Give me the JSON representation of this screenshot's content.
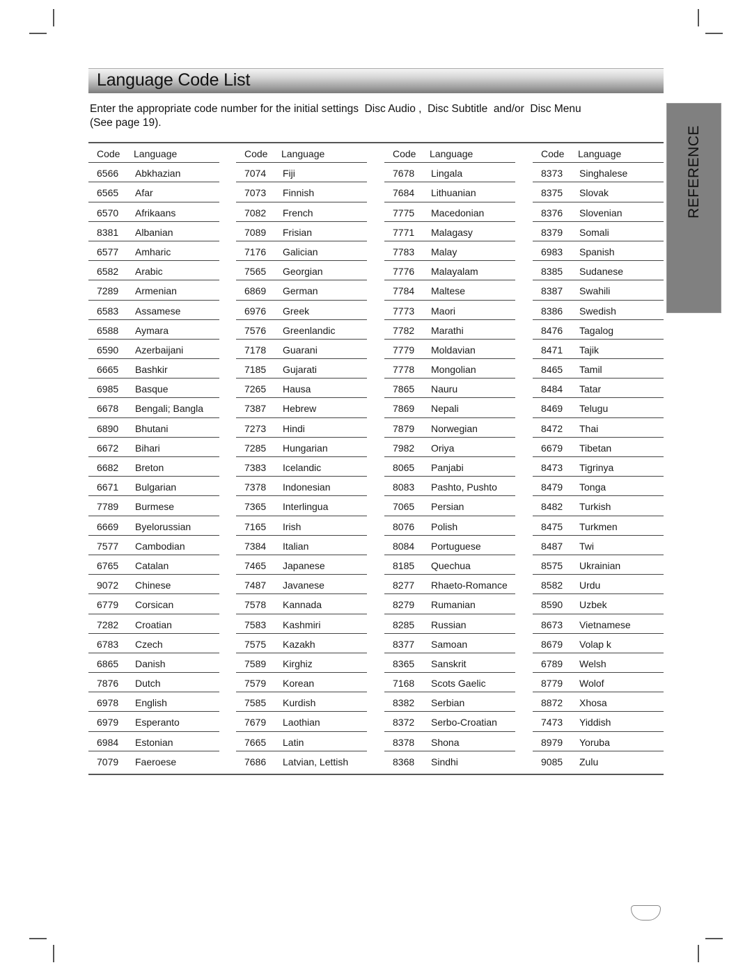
{
  "page": {
    "title": "Language Code List",
    "intro": "Enter the appropriate code number for the initial settings  Disc Audio ,  Disc Subtitle  and/or  Disc Menu",
    "intro_line2": "(See page 19).",
    "side_tab": "REFERENCE",
    "page_number": ""
  },
  "table": {
    "headers": {
      "code": "Code",
      "language": "Language"
    },
    "columns": [
      [
        {
          "code": "6566",
          "language": "Abkhazian"
        },
        {
          "code": "6565",
          "language": "Afar"
        },
        {
          "code": "6570",
          "language": "Afrikaans"
        },
        {
          "code": "8381",
          "language": "Albanian"
        },
        {
          "code": "6577",
          "language": "Amharic"
        },
        {
          "code": "6582",
          "language": "Arabic"
        },
        {
          "code": "7289",
          "language": "Armenian"
        },
        {
          "code": "6583",
          "language": "Assamese"
        },
        {
          "code": "6588",
          "language": "Aymara"
        },
        {
          "code": "6590",
          "language": "Azerbaijani"
        },
        {
          "code": "6665",
          "language": "Bashkir"
        },
        {
          "code": "6985",
          "language": "Basque"
        },
        {
          "code": "6678",
          "language": "Bengali; Bangla"
        },
        {
          "code": "6890",
          "language": "Bhutani"
        },
        {
          "code": "6672",
          "language": "Bihari"
        },
        {
          "code": "6682",
          "language": "Breton"
        },
        {
          "code": "6671",
          "language": "Bulgarian"
        },
        {
          "code": "7789",
          "language": "Burmese"
        },
        {
          "code": "6669",
          "language": "Byelorussian"
        },
        {
          "code": "7577",
          "language": "Cambodian"
        },
        {
          "code": "6765",
          "language": "Catalan"
        },
        {
          "code": "9072",
          "language": "Chinese"
        },
        {
          "code": "6779",
          "language": "Corsican"
        },
        {
          "code": "7282",
          "language": "Croatian"
        },
        {
          "code": "6783",
          "language": "Czech"
        },
        {
          "code": "6865",
          "language": "Danish"
        },
        {
          "code": "7876",
          "language": "Dutch"
        },
        {
          "code": "6978",
          "language": "English"
        },
        {
          "code": "6979",
          "language": "Esperanto"
        },
        {
          "code": "6984",
          "language": "Estonian"
        },
        {
          "code": "7079",
          "language": "Faeroese"
        }
      ],
      [
        {
          "code": "7074",
          "language": "Fiji"
        },
        {
          "code": "7073",
          "language": "Finnish"
        },
        {
          "code": "7082",
          "language": "French"
        },
        {
          "code": "7089",
          "language": "Frisian"
        },
        {
          "code": "7176",
          "language": "Galician"
        },
        {
          "code": "7565",
          "language": "Georgian"
        },
        {
          "code": "6869",
          "language": "German"
        },
        {
          "code": "6976",
          "language": "Greek"
        },
        {
          "code": "7576",
          "language": "Greenlandic"
        },
        {
          "code": "7178",
          "language": "Guarani"
        },
        {
          "code": "7185",
          "language": "Gujarati"
        },
        {
          "code": "7265",
          "language": "Hausa"
        },
        {
          "code": "7387",
          "language": "Hebrew"
        },
        {
          "code": "7273",
          "language": "Hindi"
        },
        {
          "code": "7285",
          "language": "Hungarian"
        },
        {
          "code": "7383",
          "language": "Icelandic"
        },
        {
          "code": "7378",
          "language": "Indonesian"
        },
        {
          "code": "7365",
          "language": "Interlingua"
        },
        {
          "code": "7165",
          "language": "Irish"
        },
        {
          "code": "7384",
          "language": "Italian"
        },
        {
          "code": "7465",
          "language": "Japanese"
        },
        {
          "code": "7487",
          "language": "Javanese"
        },
        {
          "code": "7578",
          "language": "Kannada"
        },
        {
          "code": "7583",
          "language": "Kashmiri"
        },
        {
          "code": "7575",
          "language": "Kazakh"
        },
        {
          "code": "7589",
          "language": "Kirghiz"
        },
        {
          "code": "7579",
          "language": "Korean"
        },
        {
          "code": "7585",
          "language": "Kurdish"
        },
        {
          "code": "7679",
          "language": "Laothian"
        },
        {
          "code": "7665",
          "language": "Latin"
        },
        {
          "code": "7686",
          "language": "Latvian, Lettish"
        }
      ],
      [
        {
          "code": "7678",
          "language": "Lingala"
        },
        {
          "code": "7684",
          "language": "Lithuanian"
        },
        {
          "code": "7775",
          "language": "Macedonian"
        },
        {
          "code": "7771",
          "language": "Malagasy"
        },
        {
          "code": "7783",
          "language": "Malay"
        },
        {
          "code": "7776",
          "language": "Malayalam"
        },
        {
          "code": "7784",
          "language": "Maltese"
        },
        {
          "code": "7773",
          "language": "Maori"
        },
        {
          "code": "7782",
          "language": "Marathi"
        },
        {
          "code": "7779",
          "language": "Moldavian"
        },
        {
          "code": "7778",
          "language": "Mongolian"
        },
        {
          "code": "7865",
          "language": "Nauru"
        },
        {
          "code": "7869",
          "language": "Nepali"
        },
        {
          "code": "7879",
          "language": "Norwegian"
        },
        {
          "code": "7982",
          "language": "Oriya"
        },
        {
          "code": "8065",
          "language": "Panjabi"
        },
        {
          "code": "8083",
          "language": "Pashto, Pushto"
        },
        {
          "code": "7065",
          "language": "Persian"
        },
        {
          "code": "8076",
          "language": "Polish"
        },
        {
          "code": "8084",
          "language": "Portuguese"
        },
        {
          "code": "8185",
          "language": "Quechua"
        },
        {
          "code": "8277",
          "language": "Rhaeto-Romance"
        },
        {
          "code": "8279",
          "language": "Rumanian"
        },
        {
          "code": "8285",
          "language": "Russian"
        },
        {
          "code": "8377",
          "language": "Samoan"
        },
        {
          "code": "8365",
          "language": "Sanskrit"
        },
        {
          "code": "7168",
          "language": "Scots Gaelic"
        },
        {
          "code": "8382",
          "language": "Serbian"
        },
        {
          "code": "8372",
          "language": "Serbo-Croatian"
        },
        {
          "code": "8378",
          "language": "Shona"
        },
        {
          "code": "8368",
          "language": "Sindhi"
        }
      ],
      [
        {
          "code": "8373",
          "language": "Singhalese"
        },
        {
          "code": "8375",
          "language": "Slovak"
        },
        {
          "code": "8376",
          "language": "Slovenian"
        },
        {
          "code": "8379",
          "language": "Somali"
        },
        {
          "code": "6983",
          "language": "Spanish"
        },
        {
          "code": "8385",
          "language": "Sudanese"
        },
        {
          "code": "8387",
          "language": "Swahili"
        },
        {
          "code": "8386",
          "language": "Swedish"
        },
        {
          "code": "8476",
          "language": "Tagalog"
        },
        {
          "code": "8471",
          "language": "Tajik"
        },
        {
          "code": "8465",
          "language": "Tamil"
        },
        {
          "code": "8484",
          "language": "Tatar"
        },
        {
          "code": "8469",
          "language": "Telugu"
        },
        {
          "code": "8472",
          "language": "Thai"
        },
        {
          "code": "6679",
          "language": "Tibetan"
        },
        {
          "code": "8473",
          "language": "Tigrinya"
        },
        {
          "code": "8479",
          "language": "Tonga"
        },
        {
          "code": "8482",
          "language": "Turkish"
        },
        {
          "code": "8475",
          "language": "Turkmen"
        },
        {
          "code": "8487",
          "language": "Twi"
        },
        {
          "code": "8575",
          "language": "Ukrainian"
        },
        {
          "code": "8582",
          "language": "Urdu"
        },
        {
          "code": "8590",
          "language": "Uzbek"
        },
        {
          "code": "8673",
          "language": "Vietnamese"
        },
        {
          "code": "8679",
          "language": "Volap k"
        },
        {
          "code": "6789",
          "language": "Welsh"
        },
        {
          "code": "8779",
          "language": "Wolof"
        },
        {
          "code": "8872",
          "language": "Xhosa"
        },
        {
          "code": "7473",
          "language": "Yiddish"
        },
        {
          "code": "8979",
          "language": "Yoruba"
        },
        {
          "code": "9085",
          "language": "Zulu"
        }
      ]
    ]
  }
}
